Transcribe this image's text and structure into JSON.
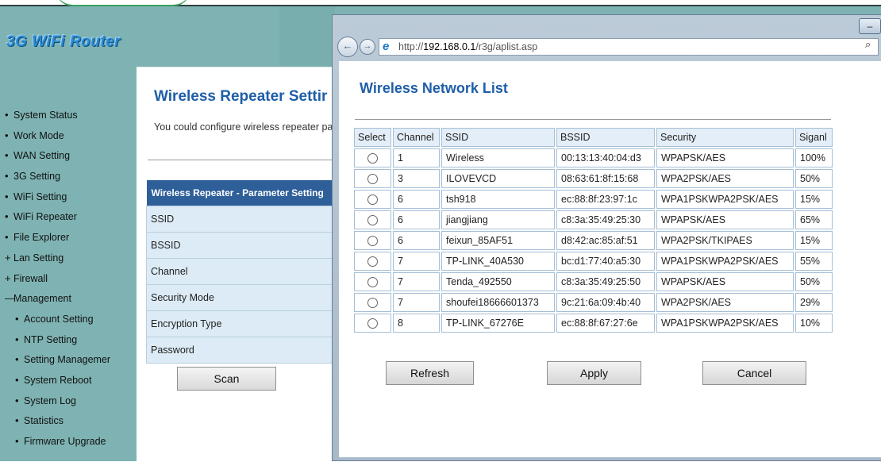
{
  "router": {
    "logo": "3G WiFi Router",
    "nav": [
      {
        "label": "System Status",
        "marker": "•",
        "level": "top"
      },
      {
        "label": "Work Mode",
        "marker": "•",
        "level": "top"
      },
      {
        "label": "WAN Setting",
        "marker": "•",
        "level": "top"
      },
      {
        "label": "3G Setting",
        "marker": "•",
        "level": "top"
      },
      {
        "label": "WiFi Setting",
        "marker": "•",
        "level": "top"
      },
      {
        "label": "WiFi Repeater",
        "marker": "•",
        "level": "top"
      },
      {
        "label": "File Explorer",
        "marker": "•",
        "level": "top"
      },
      {
        "label": "Lan Setting",
        "marker": "+",
        "level": "top"
      },
      {
        "label": "Firewall",
        "marker": "+",
        "level": "top"
      },
      {
        "label": "Management",
        "marker": "—",
        "level": "top"
      },
      {
        "label": "Account Setting",
        "marker": "•",
        "level": "sub"
      },
      {
        "label": "NTP Setting",
        "marker": "•",
        "level": "sub"
      },
      {
        "label": "Setting Managemer",
        "marker": "•",
        "level": "sub"
      },
      {
        "label": "System Reboot",
        "marker": "•",
        "level": "sub"
      },
      {
        "label": "System Log",
        "marker": "•",
        "level": "sub"
      },
      {
        "label": "Statistics",
        "marker": "•",
        "level": "sub"
      },
      {
        "label": "Firmware Upgrade",
        "marker": "•",
        "level": "sub"
      }
    ],
    "main": {
      "title": "Wireless Repeater Settir",
      "description": "You could configure wireless repeater pa",
      "table_header": "Wireless Repeater - Parameter Setting",
      "fields": [
        "SSID",
        "BSSID",
        "Channel",
        "Security Mode",
        "Encryption Type",
        "Password"
      ],
      "scan_label": "Scan"
    }
  },
  "popup": {
    "url_prefix": "http://",
    "url_host": "192.168.0.1",
    "url_path": "/r3g/aplist.asp",
    "minimize": "–",
    "title": "Wireless Network List",
    "columns": [
      "Select",
      "Channel",
      "SSID",
      "BSSID",
      "Security",
      "Siganl"
    ],
    "networks": [
      {
        "channel": "1",
        "ssid": "Wireless",
        "bssid": "00:13:13:40:04:d3",
        "security": "WPAPSK/AES",
        "signal": "100%"
      },
      {
        "channel": "3",
        "ssid": "ILOVEVCD",
        "bssid": "08:63:61:8f:15:68",
        "security": "WPA2PSK/AES",
        "signal": "50%"
      },
      {
        "channel": "6",
        "ssid": "tsh918",
        "bssid": "ec:88:8f:23:97:1c",
        "security": "WPA1PSKWPA2PSK/AES",
        "signal": "15%"
      },
      {
        "channel": "6",
        "ssid": "jiangjiang",
        "bssid": "c8:3a:35:49:25:30",
        "security": "WPAPSK/AES",
        "signal": "65%"
      },
      {
        "channel": "6",
        "ssid": "feixun_85AF51",
        "bssid": "d8:42:ac:85:af:51",
        "security": "WPA2PSK/TKIPAES",
        "signal": "15%"
      },
      {
        "channel": "7",
        "ssid": "TP-LINK_40A530",
        "bssid": "bc:d1:77:40:a5:30",
        "security": "WPA1PSKWPA2PSK/AES",
        "signal": "55%"
      },
      {
        "channel": "7",
        "ssid": "Tenda_492550",
        "bssid": "c8:3a:35:49:25:50",
        "security": "WPAPSK/AES",
        "signal": "50%"
      },
      {
        "channel": "7",
        "ssid": "shoufei18666601373",
        "bssid": "9c:21:6a:09:4b:40",
        "security": "WPA2PSK/AES",
        "signal": "29%"
      },
      {
        "channel": "8",
        "ssid": "TP-LINK_67276E",
        "bssid": "ec:88:8f:67:27:6e",
        "security": "WPA1PSKWPA2PSK/AES",
        "signal": "10%"
      }
    ],
    "buttons": {
      "refresh": "Refresh",
      "apply": "Apply",
      "cancel": "Cancel"
    }
  }
}
